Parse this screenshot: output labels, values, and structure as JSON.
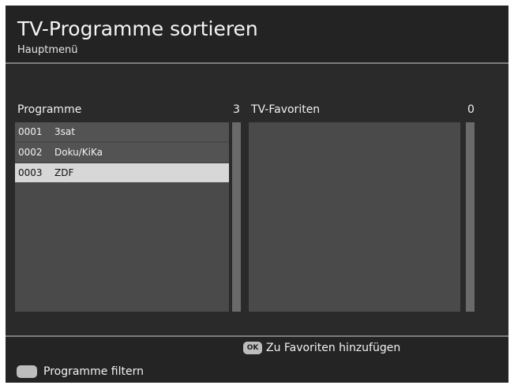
{
  "header": {
    "title": "TV-Programme sortieren",
    "subtitle": "Hauptmenü"
  },
  "left_panel": {
    "title": "Programme",
    "count": "3",
    "items": [
      {
        "number": "0001",
        "name": "3sat",
        "selected": false
      },
      {
        "number": "0002",
        "name": "Doku/KiKa",
        "selected": false
      },
      {
        "number": "0003",
        "name": "ZDF",
        "selected": true
      }
    ]
  },
  "right_panel": {
    "title": "TV-Favoriten",
    "count": "0",
    "items": []
  },
  "footer": {
    "ok_icon_label": "OK",
    "ok_action": "Zu Favoriten hinzufügen",
    "filter_action": "Programme filtern"
  },
  "colors": {
    "background": "#262626",
    "list_background": "#4a4a4a",
    "selected_row": "#d7d7d7",
    "scrollbar": "#6a6a6a",
    "rule": "#7d7d7d"
  }
}
